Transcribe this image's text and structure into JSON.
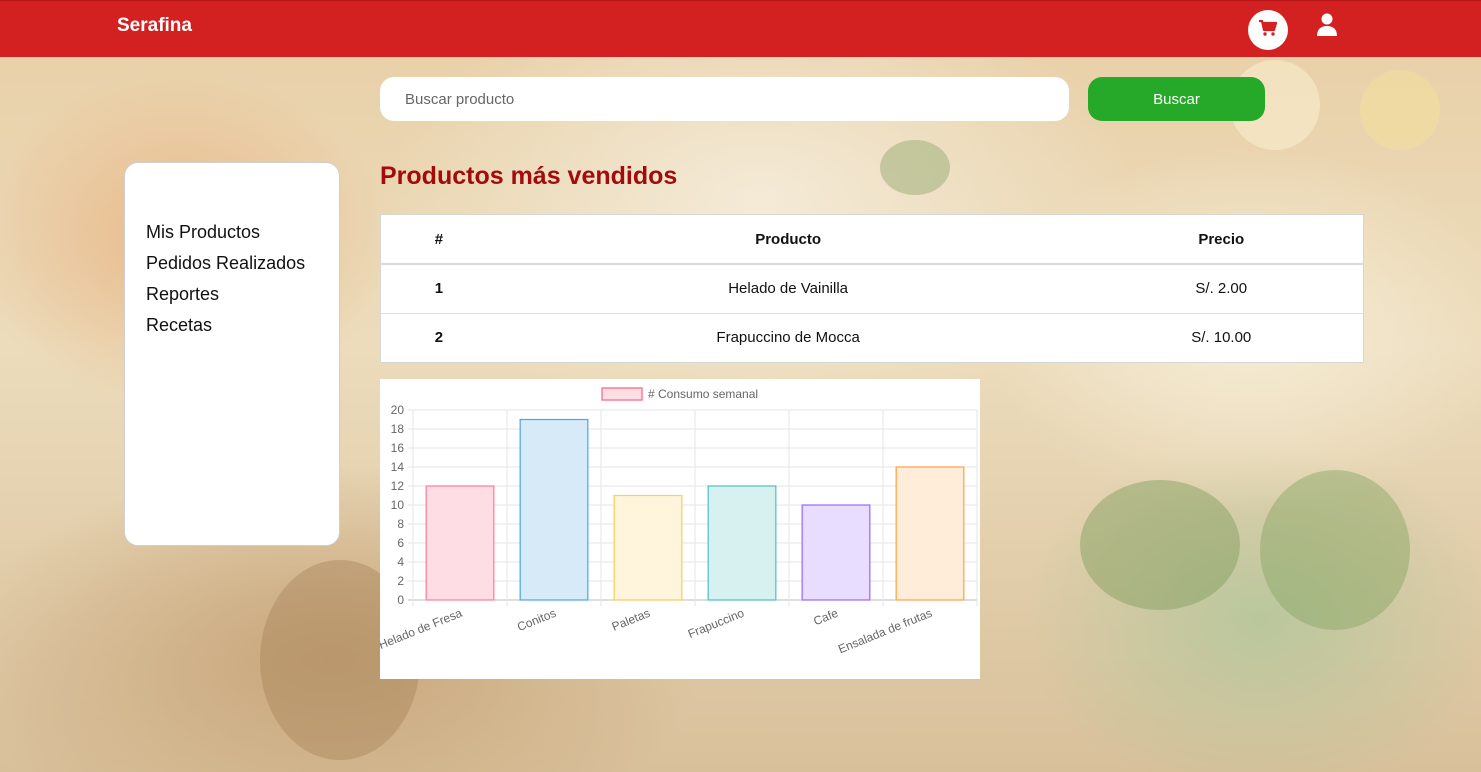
{
  "app": {
    "brand": "Serafina"
  },
  "header": {
    "cart_icon": "cart-icon",
    "user_icon": "user-icon"
  },
  "search": {
    "placeholder": "Buscar producto",
    "value": "",
    "button_label": "Buscar"
  },
  "sidebar": {
    "items": [
      {
        "label": "Mis Productos"
      },
      {
        "label": "Pedidos Realizados"
      },
      {
        "label": "Reportes"
      },
      {
        "label": "Recetas"
      }
    ]
  },
  "main": {
    "title": "Productos más vendidos",
    "table": {
      "headers": [
        "#",
        "Producto",
        "Precio"
      ],
      "rows": [
        {
          "num": "1",
          "product": "Helado de Vainilla",
          "price": "S/. 2.00"
        },
        {
          "num": "2",
          "product": "Frapuccino de Mocca",
          "price": "S/. 10.00"
        }
      ]
    }
  },
  "colors": {
    "navbar": "#d32121",
    "search_button": "#26a829",
    "title": "#a30c0c"
  },
  "chart_data": {
    "type": "bar",
    "categories": [
      "Helado de Fresa",
      "Conitos",
      "Paletas",
      "Frapuccino",
      "Cafe",
      "Ensalada de frutas"
    ],
    "series": [
      {
        "name": "# Consumo semanal",
        "values": [
          12,
          19,
          11,
          12,
          10,
          14
        ]
      }
    ],
    "bar_fills": [
      "#ffdde4",
      "#d6eaf8",
      "#fff4dc",
      "#d7f0f0",
      "#e8ddff",
      "#ffecd9"
    ],
    "bar_strokes": [
      "#ff7b98",
      "#4aa6e8",
      "#ffcc55",
      "#4bc0c0",
      "#9966ff",
      "#ffa040"
    ],
    "legend_swatch": {
      "fill": "#ffdde4",
      "stroke": "#ff7b98"
    },
    "ylim": [
      0,
      20
    ],
    "yticks": [
      0,
      2,
      4,
      6,
      8,
      10,
      12,
      14,
      16,
      18,
      20
    ],
    "legend_position": "top",
    "grid": true
  }
}
